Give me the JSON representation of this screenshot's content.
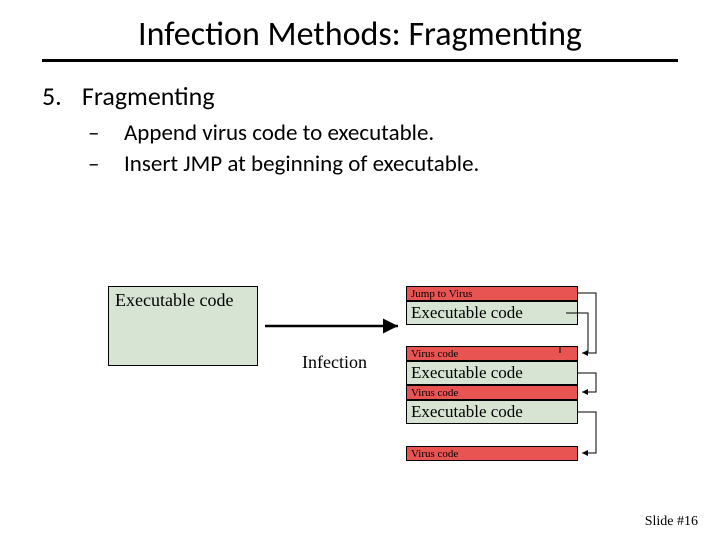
{
  "title": "Infection Methods: Fragmenting",
  "section": {
    "number": "5.",
    "label": "Fragmenting"
  },
  "bullets": [
    "Append virus code to executable.",
    "Insert JMP at beginning of executable."
  ],
  "diagram": {
    "left_box": "Executable code",
    "arrow_label": "Infection",
    "right": {
      "r1": "Jump to Virus",
      "r2": "Executable code",
      "r3": "Virus code",
      "r4": "Executable code",
      "r5": "Virus code",
      "r6": "Executable code",
      "r7": "Virus code"
    }
  },
  "slide_number": "Slide #16"
}
